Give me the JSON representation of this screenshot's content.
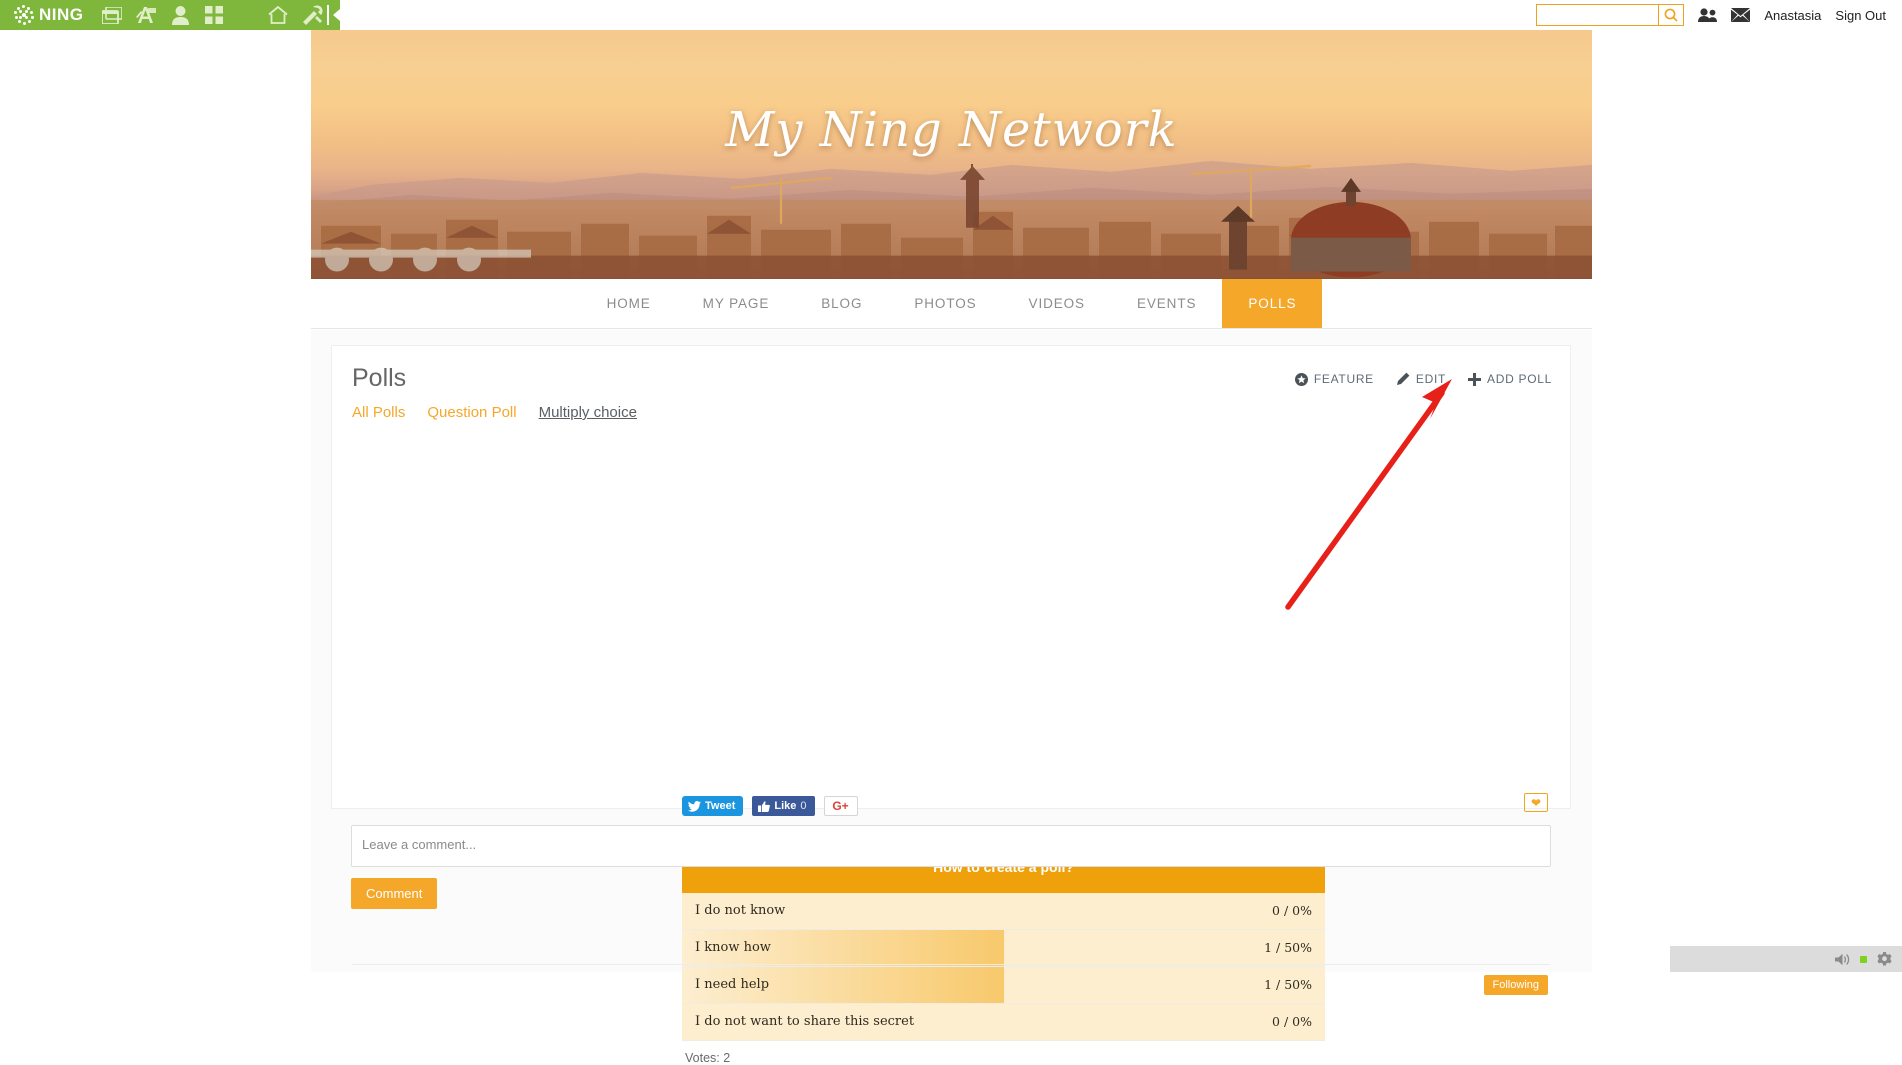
{
  "admin_bar": {
    "logo_text": "NING",
    "icons": [
      {
        "name": "windows-icon",
        "label": "Windows"
      },
      {
        "name": "app-designer-icon",
        "label": "App Designer"
      },
      {
        "name": "person-icon",
        "label": "Profile"
      },
      {
        "name": "grid-icon",
        "label": "Apps Grid"
      },
      {
        "name": "home-icon",
        "label": "Home"
      },
      {
        "name": "tools-icon",
        "label": "Tools"
      }
    ],
    "collapse_label": "Collapse",
    "search_value": "",
    "search_placeholder": "",
    "search_icon": "search-icon",
    "members_icon": "members-icon",
    "messages_icon": "mail-icon",
    "username": "Anastasia",
    "signout_label": "Sign Out"
  },
  "banner": {
    "site_title": "My Ning Network"
  },
  "nav": {
    "items": [
      {
        "label": "HOME",
        "active": false
      },
      {
        "label": "MY PAGE",
        "active": false
      },
      {
        "label": "BLOG",
        "active": false
      },
      {
        "label": "PHOTOS",
        "active": false
      },
      {
        "label": "VIDEOS",
        "active": false
      },
      {
        "label": "EVENTS",
        "active": false
      },
      {
        "label": "POLLS",
        "active": true
      }
    ]
  },
  "polls_page": {
    "title": "Polls",
    "actions": [
      {
        "label": "FEATURE",
        "icon": "feature-star-icon"
      },
      {
        "label": "EDIT",
        "icon": "pencil-icon"
      },
      {
        "label": "ADD POLL",
        "icon": "plus-icon"
      }
    ],
    "tabs": [
      {
        "label": "All Polls",
        "active": false
      },
      {
        "label": "Question Poll",
        "active": false
      },
      {
        "label": "Multiply choice",
        "active": true
      }
    ]
  },
  "social": {
    "tweet_label": "Tweet",
    "like_label": "Like",
    "like_count": "0",
    "gplus_label": "G+",
    "favorite_icon": "heart-icon"
  },
  "poll": {
    "question": "How to create a poll?",
    "options": [
      {
        "label": "I do not know",
        "votes": 0,
        "percent": 0,
        "result": "0 / 0%"
      },
      {
        "label": "I know how",
        "votes": 1,
        "percent": 50,
        "result": "1 / 50%"
      },
      {
        "label": "I need help",
        "votes": 1,
        "percent": 50,
        "result": "1 / 50%"
      },
      {
        "label": "I do not want to share this secret",
        "votes": 0,
        "percent": 0,
        "result": "0 / 0%"
      }
    ],
    "votes_total_label": "Votes: 2",
    "following_label": "Following"
  },
  "comment": {
    "placeholder": "Leave a comment...",
    "value": "",
    "button_label": "Comment"
  },
  "system_bar": {
    "volume_icon": "speaker-icon",
    "status_icon": "status-dot",
    "settings_icon": "gear-icon"
  },
  "colors": {
    "accent_orange": "#f5a72a",
    "poll_header_orange": "#efa10b",
    "ning_green": "#7fb63c",
    "annotation_red": "#e8201a",
    "tweet_blue": "#1b95e0",
    "facebook_blue": "#3b5998",
    "gplus_red": "#db4437"
  }
}
